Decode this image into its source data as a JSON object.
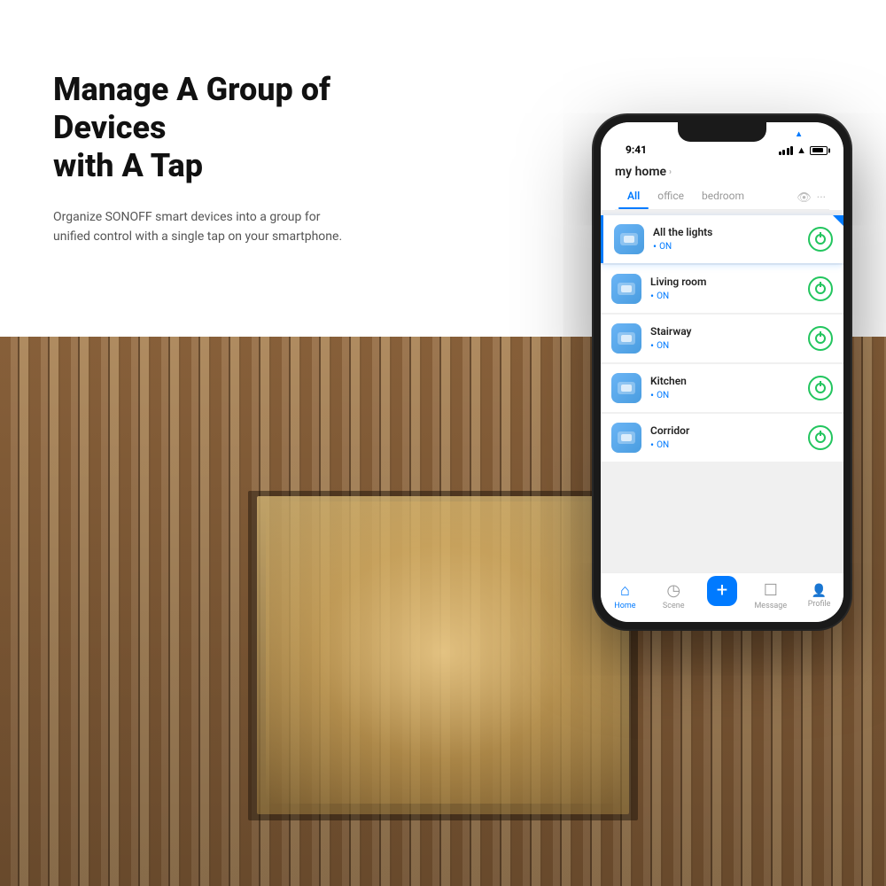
{
  "heading": {
    "main": "Manage A Group of Devices",
    "sub": "with A Tap",
    "description": "Organize SONOFF smart devices into a group for unified control with a single tap on your smartphone."
  },
  "phone": {
    "status_bar": {
      "time": "9:41",
      "signal": true,
      "wifi": true,
      "battery": true
    },
    "app": {
      "title": "my home",
      "chevron": "›",
      "tabs": [
        {
          "label": "All",
          "active": true
        },
        {
          "label": "office",
          "active": false
        },
        {
          "label": "bedroom",
          "active": false
        }
      ]
    },
    "devices": [
      {
        "name": "All the lights",
        "status": "ON",
        "highlighted": true
      },
      {
        "name": "Living room",
        "status": "ON",
        "highlighted": false
      },
      {
        "name": "Stairway",
        "status": "ON",
        "highlighted": false
      },
      {
        "name": "Kitchen",
        "status": "ON",
        "highlighted": false
      },
      {
        "name": "Corridor",
        "status": "ON",
        "highlighted": false
      }
    ],
    "nav": [
      {
        "label": "Home",
        "active": true,
        "icon": "⌂"
      },
      {
        "label": "Scene",
        "active": false,
        "icon": "◷"
      },
      {
        "label": "+",
        "active": false,
        "icon": "+"
      },
      {
        "label": "Message",
        "active": false,
        "icon": "☐"
      },
      {
        "label": "Profile",
        "active": false,
        "icon": "👤"
      }
    ]
  },
  "colors": {
    "accent": "#007AFF",
    "on_status": "#22c55e",
    "heading_dark": "#111111",
    "text_gray": "#555555"
  }
}
